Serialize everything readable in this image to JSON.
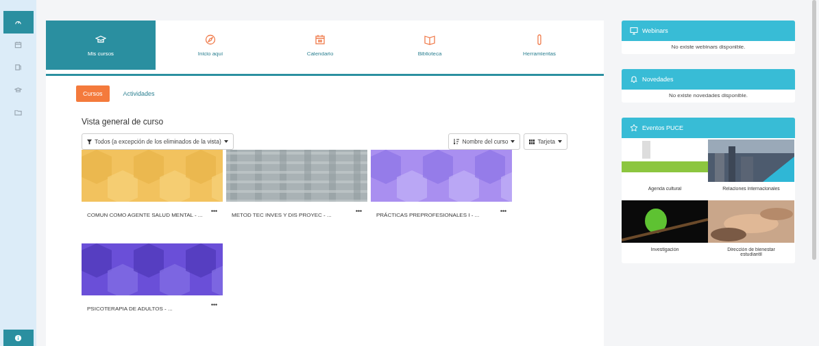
{
  "sidebar": {
    "items": [
      {
        "selected": true
      },
      {
        "selected": false
      },
      {
        "selected": false
      },
      {
        "selected": false
      },
      {
        "selected": false
      }
    ]
  },
  "tabs": [
    {
      "label": "Mis cursos",
      "selected": true
    },
    {
      "label": "Inicio aquí",
      "selected": false
    },
    {
      "label": "Calendario",
      "selected": false
    },
    {
      "label": "Biblioteca",
      "selected": false
    },
    {
      "label": "Herramientas",
      "selected": false
    }
  ],
  "subtabs": [
    {
      "label": "Cursos",
      "selected": true
    },
    {
      "label": "Actividades",
      "selected": false
    }
  ],
  "overview": {
    "title": "Vista general de curso",
    "filter": "Todos (a excepción de los eliminados de la vista)",
    "sort": "Nombre del curso",
    "view": "Tarjeta"
  },
  "courses": [
    {
      "title": "COMUN COMO AGENTE SALUD MENTAL - ..."
    },
    {
      "title": "METOD TEC INVES Y DIS PROYEC - ..."
    },
    {
      "title": "PRÁCTICAS PREPROFESIONALES I - ..."
    },
    {
      "title": "PSICOTERAPIA DE ADULTOS - ..."
    }
  ],
  "blocks": [
    {
      "title": "Webinars",
      "message": "No existe webinars disponible."
    },
    {
      "title": "Novedades",
      "message": "No existe novedades disponible."
    }
  ],
  "events": {
    "title": "Eventos PUCE",
    "items": [
      {
        "label": "Agenda cultural"
      },
      {
        "label": "Relaciones internacionales"
      },
      {
        "label": "Investigación"
      },
      {
        "label": "Dirección de bienestar estudiantil"
      }
    ]
  }
}
